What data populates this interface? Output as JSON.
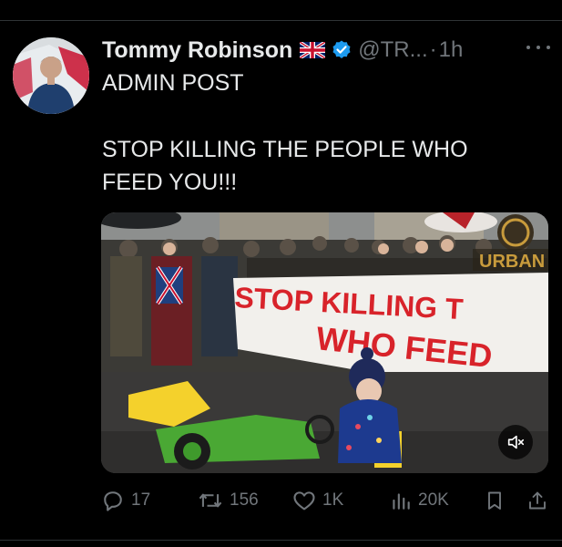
{
  "post": {
    "author_name": "Tommy Robinson",
    "handle": "@TR...",
    "separator": "·",
    "time": "1h",
    "text_lines": [
      "ADMIN POST",
      "",
      "STOP KILLING THE PEOPLE WHO",
      "FEED YOU!!!"
    ]
  },
  "icons": {
    "flag": "uk-flag-icon",
    "verified": "verified-badge-icon",
    "more": "more-options-icon",
    "mute": "muted-speaker-icon"
  },
  "media": {
    "banner_line1": "STOP KILLING T",
    "banner_line2": "WHO FEED",
    "logo_text": "URBAN"
  },
  "actions": {
    "replies": "17",
    "reposts": "156",
    "likes": "1K",
    "views": "20K"
  },
  "colors": {
    "background": "#000000",
    "text": "#e7e9ea",
    "muted": "#71767b",
    "verified": "#1d9bf0",
    "banner_text": "#d8232a"
  }
}
